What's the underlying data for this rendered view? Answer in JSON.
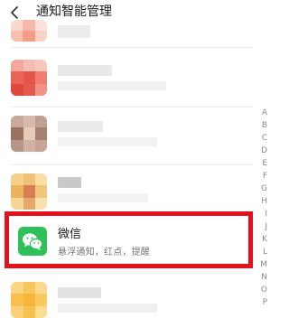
{
  "header": {
    "title": "通知智能管理"
  },
  "index_letters": [
    "A",
    "B",
    "C",
    "D",
    "E",
    "F",
    "G",
    "H",
    "I",
    "J",
    "K",
    "L",
    "M",
    "N",
    "O",
    "P"
  ],
  "highlighted_app": {
    "name": "微信",
    "subtitle": "悬浮通知，红点，提醒"
  },
  "colors": {
    "highlight_border": "#e6101a",
    "wechat_green": "#2dc158"
  },
  "icons": {
    "back": "chevron-left-icon",
    "wechat": "wechat-icon"
  }
}
